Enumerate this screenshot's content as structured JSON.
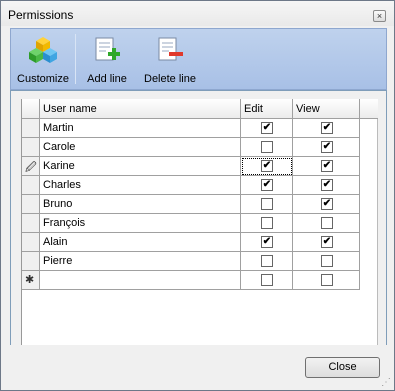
{
  "window": {
    "title": "Permissions",
    "close_glyph": "×"
  },
  "toolbar": {
    "buttons": [
      {
        "label": "Customize",
        "icon": "customize-cubes-icon"
      },
      {
        "label": "Add line",
        "icon": "add-line-icon"
      },
      {
        "label": "Delete line",
        "icon": "delete-line-icon"
      }
    ]
  },
  "grid": {
    "columns": [
      "User name",
      "Edit",
      "View"
    ],
    "rows": [
      {
        "name": "Martin",
        "edit": true,
        "view": true
      },
      {
        "name": "Carole",
        "edit": false,
        "view": true
      },
      {
        "name": "Karine",
        "edit": true,
        "view": true,
        "editing": true
      },
      {
        "name": "Charles",
        "edit": true,
        "view": true
      },
      {
        "name": "Bruno",
        "edit": false,
        "view": true
      },
      {
        "name": "François",
        "edit": false,
        "view": false
      },
      {
        "name": "Alain",
        "edit": true,
        "view": true
      },
      {
        "name": "Pierre",
        "edit": false,
        "view": false
      },
      {
        "name": "",
        "edit": false,
        "view": false,
        "new_row": true
      }
    ],
    "editing_glyph": "🖉",
    "new_row_glyph": "✱",
    "check_glyph": "✔"
  },
  "footer": {
    "close_label": "Close"
  }
}
